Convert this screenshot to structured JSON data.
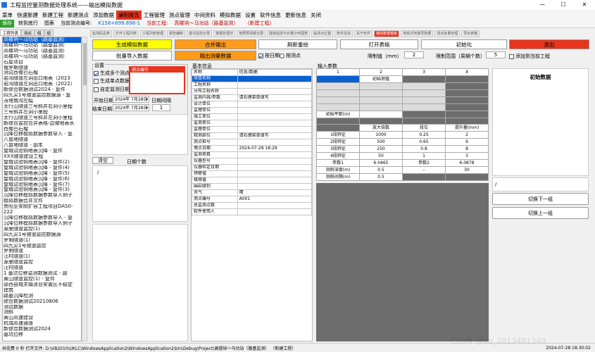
{
  "window": {
    "title": "工程监控量测数据处理系统——输出模拟数据",
    "minimize": "—",
    "maximize": "☐",
    "close": "✕"
  },
  "menu": [
    "菜单",
    "快速新建",
    "新建工程",
    "新建测点",
    "添加数据",
    "编制报告",
    "工程管理",
    "测点管理",
    "中间资料",
    "模拟数据",
    "设置",
    "软件信息",
    "更新信息",
    "关闭"
  ],
  "toolbar": {
    "save": "保存",
    "jump": "转到底行",
    "chart": "图表",
    "current_no_label": "当前测点编号:",
    "current_no": "K158+699.898-1",
    "current_proj_label": "当前工程:",
    "current_proj": "高楼垧～马功站（路基监测）",
    "new_proj": "（新建工程）"
  },
  "left_tabs": [
    "工程列表",
    "测点",
    "组",
    "组"
  ],
  "left_list": [
    "高楼垧～马功站（路基监测）",
    "高楼垧～马功站（路基监测）",
    "高楼垧～马功站（路基监测）",
    "高楼垧～马功站（路基监测）",
    "石屋项目",
    "俄罗斯隧道",
    "测试西蜀巴石榴",
    "岩湾隧道左洞出口地表（2023",
    "岩湾隧道左洞出口地表（2022）",
    "新综合数据测试2024 - 复件",
    "四九尖1号隧道监控数据源 - 复",
    "茂塔南沟左幅",
    "太行山隧道三号斜井右洞小里程",
    "三号斜井左洞小里程",
    "太行山隧道三号斜井左洞小里程",
    "新综合监控合并表格-边坡地表水",
    "西蜀巴石榴",
    "沉降位移模拟数据参数导入 - 复",
    "八亩地隧道",
    "八亩地隧道 - 副本",
    "望城试验铜地表沉降 - 复件",
    "XXX隧道建设工程",
    "望城试验铜地表沉降 - 复件(2)",
    "望城试验铜地表沉降 - 复件(4)",
    "望城试验铜地表沉降 - 复件(5)",
    "望城试验铜地表沉降 - 复件(6)",
    "望城试验铜地表沉降 - 复件(7)",
    "望城试验铜地表沉降 - 复件(3)",
    "沉降位移模拟数据参数导入例子",
    "模拟数据合并文件",
    "贵阳至安顺扩容工程项目DAS0-",
    "222",
    "沉降位移模拟数据参数导入 - 复",
    "沉降位移模拟数据参数导入例子",
    "源里隧道监控(1)",
    "四九尖1号隧道监控数据源",
    "罗俐隧道(1)",
    "四九尖1号隧道监控",
    "罗俐隧道",
    "汪村隧道(1)",
    "源里隧道监控",
    "汪村隧道",
    "1 基坑位移监测数据测试 - 副",
    "黄山隧道监控(1) - 复件",
    "邵西县城关镇清台安置区不稳定",
    "建筑",
    "路基沉降检测",
    "综合数据测试20210806",
    "测试数据",
    "测斜",
    "黄山高速建设",
    "杭瑞高速通道",
    "新综合数据测试2024",
    "基坑位移"
  ],
  "right_tabs": [
    "监测段总表",
    "打开工程列表",
    "工程列表管理",
    "报告编制",
    "基坑监控记录",
    "数据处理日",
    "地质预测报记录",
    "隧道监控与日量分布图表",
    "临测点位置",
    "软件信息",
    "关于软件",
    "模拟数据模板",
    "地铁式地量导数据",
    "测点批量管理",
    "导出表格"
  ],
  "buttons": {
    "gen_sim": "生成模拟数据",
    "merge": "合并输出",
    "refresh": "刷新重绘",
    "open_table": "打开表格",
    "init": "初始化",
    "exit": "退出",
    "batch_import": "批量导入数据",
    "output_measure": "输出测量数据",
    "clear": "清空",
    "days": "日期个数",
    "switch_next": "切换下一组",
    "switch_prev": "切换上一组"
  },
  "options": {
    "by_date": "按日期",
    "by_count": "按测点",
    "limit_label": "限制值（mm）",
    "limit_val": "2",
    "range_label": "限制范围（周期个数）",
    "range_val": "5",
    "add_to_current": "添加到当前工程"
  },
  "settings": {
    "title": "设置",
    "multi": "生成多个测点",
    "single": "生成单点数据",
    "custom_date": "自定监测日期",
    "start_label": "开始日期",
    "start_date": "2024年 7月28日",
    "interval_label": "日期间隔",
    "end_label": "结束日期",
    "end_date": "2024年 7月28日",
    "interval_val": "1",
    "popup_title": "测点编号",
    "slash": "/"
  },
  "basic_info": {
    "title": "基本信息",
    "header": [
      "名称",
      "信息/数据"
    ],
    "rows": [
      [
        "项目名称",
        ""
      ],
      [
        "工程名称",
        ""
      ],
      [
        "分布工程名称",
        ""
      ],
      [
        "监测内容/参数",
        "请右键菜单填写"
      ],
      [
        "设计单位",
        ""
      ],
      [
        "监理单位",
        ""
      ],
      [
        "施工单位",
        ""
      ],
      [
        "监测单位",
        ""
      ],
      [
        "监理单位",
        ""
      ],
      [
        "观测部位",
        "请右键菜单填写"
      ],
      [
        "测点桩号",
        ""
      ],
      [
        "埋点日期",
        "2024-07-28 18:29"
      ],
      [
        "监测项目",
        ""
      ],
      [
        "仪器型号",
        ""
      ],
      [
        "仪器检定日期",
        ""
      ],
      [
        "预警值",
        ""
      ],
      [
        "极限值",
        ""
      ],
      [
        "围岩级别",
        ""
      ],
      [
        "天气",
        "晴"
      ],
      [
        "测点编号",
        "A001"
      ],
      [
        "总监测点数",
        ""
      ],
      [
        "软件使用人",
        ""
      ]
    ]
  },
  "input_params": {
    "title": "输入参数",
    "cols": [
      "1",
      "2",
      "3",
      "4"
    ],
    "r_init_obs": "初始测值",
    "r_init_flat": "初始平距(m)",
    "grade_head": [
      "放大倍数",
      "段位",
      "提升量(mm)"
    ],
    "grades": [
      [
        "1段转征",
        "1000",
        "0.25",
        "2"
      ],
      [
        "2段转征",
        "500",
        "0.65",
        "6"
      ],
      [
        "3段转征",
        "250",
        "0.8",
        "8"
      ],
      [
        "4段转征",
        "50",
        "1",
        "3"
      ]
    ],
    "param1_label": "参数1",
    "param1_val": "6.0465",
    "param2_label": "参数2",
    "param2_val": "6.0878",
    "depth_label": "测斜深度(m)",
    "depth_val": "0.5",
    "dash": "–",
    "depth_max": "30",
    "interval_label": "测斜间隔(m)",
    "interval_val": "0.5"
  },
  "init_data": {
    "title": "初始数据",
    "slash": "/"
  },
  "status": {
    "left": "共花费 0 秒  打开文件: D:\\VB2010\\UKLC\\WindowsApplication2\\WindowsApplication2\\bin\\Debug\\Project\\高楼垧～马功站（路基监测）    （新建工程）",
    "right": "2024-07-28 18:30:02"
  },
  "watermark": "CSDN @qq_2013481349"
}
